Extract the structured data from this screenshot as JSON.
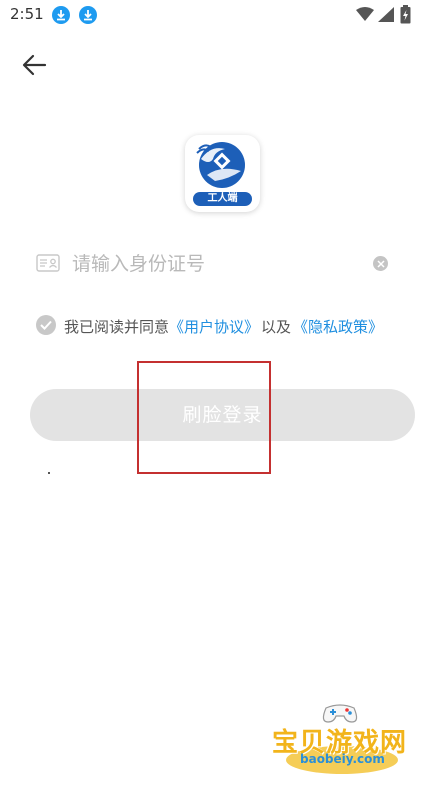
{
  "status_bar": {
    "time": "2:51",
    "icons": [
      "download-icon",
      "download-icon",
      "wifi-icon",
      "signal-icon",
      "battery-icon"
    ]
  },
  "header": {
    "back_icon": "arrow-left-icon"
  },
  "logo": {
    "badge_text": "工人端"
  },
  "id_input": {
    "placeholder": "请输入身份证号",
    "value": "",
    "icon": "id-card-icon",
    "clear_icon": "clear-icon"
  },
  "agreement": {
    "prefix": "我已阅读并同意",
    "user_agreement": "《用户协议》",
    "connector": "以及",
    "privacy_policy": "《隐私政策》"
  },
  "login_button": {
    "label": "刷脸登录"
  },
  "watermark": {
    "title": "宝贝游戏网",
    "url": "baobeiy.com"
  },
  "colors": {
    "accent": "#1f8fe0",
    "button_disabled": "#e3e3e3",
    "highlight": "#c43030",
    "logo_blue": "#1d5fb8"
  }
}
